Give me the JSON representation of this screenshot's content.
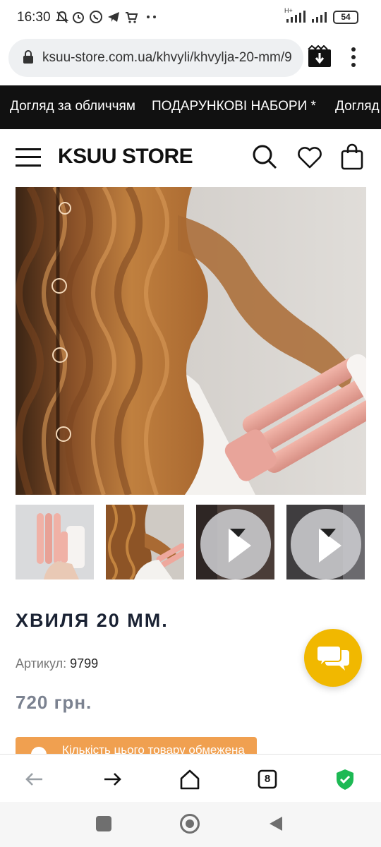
{
  "status_bar": {
    "time": "16:30",
    "network": "H+",
    "battery": "54"
  },
  "browser": {
    "url": "ksuu-store.com.ua/khvyli/khvylja-20-mm/9",
    "tab_count": "8"
  },
  "promo_bar": {
    "items": [
      "Догляд за обличчям",
      "ПОДАРУНКОВІ НАБОРИ *",
      "Догляд"
    ]
  },
  "header": {
    "logo": "KSUU STORE"
  },
  "product": {
    "title": "ХВИЛЯ 20 ММ.",
    "sku_label": "Артикул:",
    "sku_value": "9799",
    "price": "720 грн.",
    "limit_notice": "Кількість цього товару обмежена",
    "gallery": {
      "thumbnails": [
        {
          "kind": "image",
          "icon": "product-photo-icon"
        },
        {
          "kind": "image",
          "icon": "product-photo-icon"
        },
        {
          "kind": "video",
          "icon": "play-icon"
        },
        {
          "kind": "video",
          "icon": "play-icon"
        }
      ]
    }
  },
  "colors": {
    "promo_bg": "#111111",
    "chat_accent": "#f1b800",
    "limit_banner": "#f0a050",
    "shield_green": "#1db954"
  }
}
